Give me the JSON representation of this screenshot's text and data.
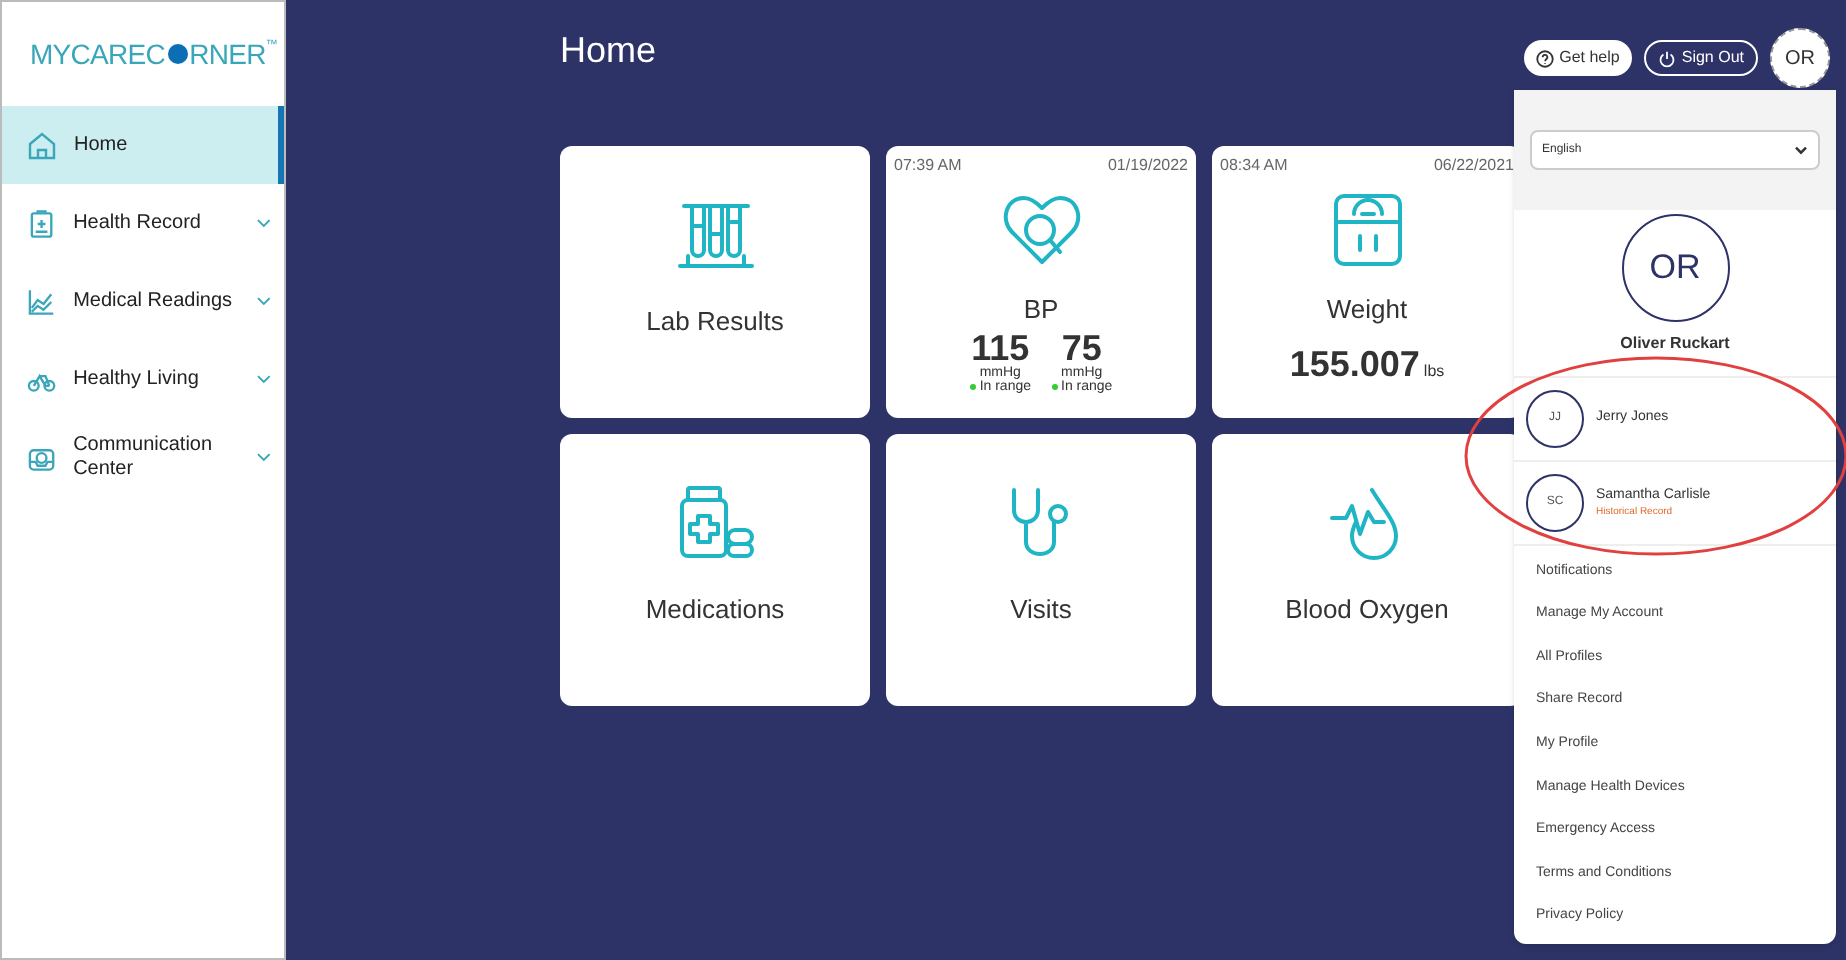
{
  "logo": {
    "before": "MYCAREC",
    "after": "RNER",
    "mark": "™"
  },
  "sidebar": {
    "items": [
      {
        "label": "Home",
        "selected": true,
        "expandable": false
      },
      {
        "label": "Health Record",
        "selected": false,
        "expandable": true
      },
      {
        "label": "Medical Readings",
        "selected": false,
        "expandable": true
      },
      {
        "label": "Healthy Living",
        "selected": false,
        "expandable": true
      },
      {
        "label": "Communication Center",
        "selected": false,
        "expandable": true
      }
    ]
  },
  "page": {
    "title": "Home"
  },
  "header": {
    "help_button": "Get help",
    "signout_button": "Sign Out",
    "avatar": "OR"
  },
  "cards": [
    {
      "kind": "plain",
      "title": "Lab Results"
    },
    {
      "kind": "bp",
      "title": "BP",
      "time": "07:39 AM",
      "date": "01/19/2022",
      "readings": [
        {
          "value": "115",
          "unit": "mmHg",
          "status": "In range"
        },
        {
          "value": "75",
          "unit": "mmHg",
          "status": "In range"
        }
      ]
    },
    {
      "kind": "weight",
      "title": "Weight",
      "time": "08:34 AM",
      "date": "06/22/2021",
      "value": "155.007",
      "unit": "lbs"
    },
    {
      "kind": "plain",
      "title": "Medications"
    },
    {
      "kind": "plain",
      "title": "Visits"
    },
    {
      "kind": "plain",
      "title": "Blood Oxygen"
    }
  ],
  "menu": {
    "language": "English",
    "user": {
      "initials": "OR",
      "name": "Oliver Ruckart"
    },
    "profiles": [
      {
        "initials": "JJ",
        "name": "Jerry Jones"
      },
      {
        "initials": "SC",
        "name": "Samantha Carlisle",
        "note": "Historical Record"
      }
    ],
    "items": [
      "Notifications",
      "Manage My Account",
      "All Profiles",
      "Share Record",
      "My Profile",
      "Manage Health Devices",
      "Emergency Access",
      "Terms and Conditions",
      "Privacy Policy"
    ]
  }
}
